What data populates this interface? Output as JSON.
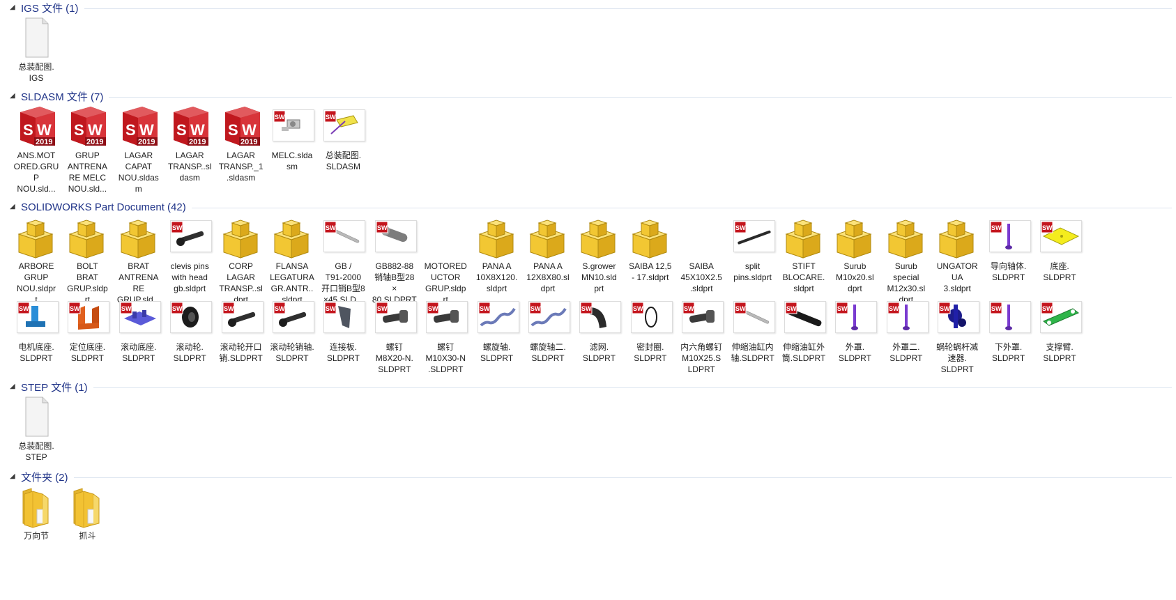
{
  "colors": {
    "group_title": "#1e3287",
    "sw_red": "#c0181e",
    "folder_yellow": "#f2c233"
  },
  "groups": [
    {
      "title": "IGS 文件 (1)",
      "items": [
        {
          "name": "总装配图.IGS",
          "lines": [
            "总装配图.",
            "IGS"
          ],
          "icon": "blank-file-icon"
        }
      ]
    },
    {
      "title": "SLDASM 文件 (7)",
      "items": [
        {
          "name": "ANS.MOTORED.GRUP NOU.sld...",
          "lines": [
            "ANS.MOT",
            "ORED.GRU",
            "P",
            "NOU.sld..."
          ],
          "icon": "sw2019-icon"
        },
        {
          "name": "GRUP ANTRENARE MELC NOU.sld...",
          "lines": [
            "GRUP",
            "ANTRENA",
            "RE MELC",
            "NOU.sld..."
          ],
          "icon": "sw2019-icon"
        },
        {
          "name": "LAGAR CAPAT NOU.sldasm",
          "lines": [
            "LAGAR",
            "CAPAT",
            "NOU.sldas",
            "m"
          ],
          "icon": "sw2019-icon"
        },
        {
          "name": "LAGAR TRANSP..sldasm",
          "lines": [
            "LAGAR",
            "TRANSP..sl",
            "dasm"
          ],
          "icon": "sw2019-icon"
        },
        {
          "name": "LAGAR TRANSP._1.sldasm",
          "lines": [
            "LAGAR",
            "TRANSP._1",
            ".sldasm"
          ],
          "icon": "sw2019-icon"
        },
        {
          "name": "MELC.sldasm",
          "lines": [
            "MELC.slda",
            "sm"
          ],
          "icon": "assembly-thumb-icon",
          "thumb": "assembly-gray"
        },
        {
          "name": "总装配图.SLDASM",
          "lines": [
            "总装配图.",
            "SLDASM"
          ],
          "icon": "assembly-thumb-icon",
          "thumb": "assembly-yellow"
        }
      ]
    },
    {
      "title": "SOLIDWORKS Part Document (42)",
      "items": [
        {
          "name": "ARBORE GRUP NOU.sldprt",
          "lines": [
            "ARBORE",
            "GRUP",
            "NOU.sldpr",
            "t"
          ],
          "icon": "part-block-icon"
        },
        {
          "name": "BOLT BRAT GRUP.sldprt",
          "lines": [
            "BOLT",
            "BRAT",
            "GRUP.sldp",
            "rt"
          ],
          "icon": "part-block-icon"
        },
        {
          "name": "BRAT ANTRENARE GRUP.sld...",
          "lines": [
            "BRAT",
            "ANTRENA",
            "RE",
            "GRUP.sld..."
          ],
          "icon": "part-block-icon"
        },
        {
          "name": "clevis pins with head gb.sldprt",
          "lines": [
            "clevis pins",
            "with head",
            "gb.sldprt"
          ],
          "icon": "part-thumb-icon",
          "thumb": "pin-dark"
        },
        {
          "name": "CORP LAGAR TRANSP..sldprt",
          "lines": [
            "CORP",
            "LAGAR",
            "TRANSP..sl",
            "dprt"
          ],
          "icon": "part-block-icon"
        },
        {
          "name": "FLANSA LEGATURA GR.ANTR..sldprt",
          "lines": [
            "FLANSA",
            "LEGATURA",
            "GR.ANTR..",
            "sldprt"
          ],
          "icon": "part-block-icon"
        },
        {
          "name": "GB / T91-2000 开口销B型8×45.SLD...",
          "lines": [
            "GB /",
            "T91-2000",
            "开口销B型8",
            "×45.SLD..."
          ],
          "icon": "part-thumb-icon",
          "thumb": "pin-silver"
        },
        {
          "name": "GB882-88 销轴B型28×80.SLDPRT",
          "lines": [
            "GB882-88",
            "销轴B型28",
            "×",
            "80.SLDPRT"
          ],
          "icon": "part-thumb-icon",
          "thumb": "shaft-gray"
        },
        {
          "name": "MOTOREDUCTOR GRUP.sldprt",
          "lines": [
            "MOTORED",
            "UCTOR",
            "GRUP.sldp",
            "rt"
          ],
          "icon": "none"
        },
        {
          "name": "PANA A 10X8X120.sldprt",
          "lines": [
            "PANA  A",
            "10X8X120.",
            "sldprt"
          ],
          "icon": "part-block-icon"
        },
        {
          "name": "PANA A 12X8X80.sldprt",
          "lines": [
            "PANA  A",
            "12X8X80.sl",
            "dprt"
          ],
          "icon": "part-block-icon"
        },
        {
          "name": "S.grower MN10.sldprt",
          "lines": [
            "S.grower",
            "MN10.sld",
            "prt"
          ],
          "icon": "part-block-icon"
        },
        {
          "name": "SAIBA 12,5 - 17.sldprt",
          "lines": [
            "SAIBA 12,5",
            "- 17.sldprt"
          ],
          "icon": "part-block-icon"
        },
        {
          "name": "SAIBA 45X10X2.5.sldprt",
          "lines": [
            "SAIBA",
            "45X10X2.5",
            ".sldprt"
          ],
          "icon": "none"
        },
        {
          "name": "split pins.sldprt",
          "lines": [
            "split",
            "pins.sldprt"
          ],
          "icon": "part-thumb-icon",
          "thumb": "pin-black"
        },
        {
          "name": "STIFT BLOCARE.sldprt",
          "lines": [
            "STIFT",
            "BLOCARE.",
            "sldprt"
          ],
          "icon": "part-block-icon"
        },
        {
          "name": "Surub M10x20.sldprt",
          "lines": [
            "Surub",
            "M10x20.sl",
            "dprt"
          ],
          "icon": "part-block-icon"
        },
        {
          "name": "Surub special M12x30.sldprt",
          "lines": [
            "Surub",
            "special",
            "M12x30.sl",
            "dprt"
          ],
          "icon": "part-block-icon"
        },
        {
          "name": "UNGATORUA 3.sldprt",
          "lines": [
            "UNGATOR",
            "UA",
            "3.sldprt"
          ],
          "icon": "part-block-icon"
        },
        {
          "name": "导向轴体.SLDPRT",
          "lines": [
            "导向轴体.",
            "SLDPRT"
          ],
          "icon": "part-thumb-icon",
          "thumb": "rod-purple"
        },
        {
          "name": "底座.SLDPRT",
          "lines": [
            "底座.",
            "SLDPRT"
          ],
          "icon": "part-thumb-icon",
          "thumb": "plate-yellow"
        },
        {
          "name": "电机底座.SLDPRT",
          "lines": [
            "电机底座.",
            "SLDPRT"
          ],
          "icon": "part-thumb-icon",
          "thumb": "mount-blue"
        },
        {
          "name": "定位底座.SLDPRT",
          "lines": [
            "定位底座.",
            "SLDPRT"
          ],
          "icon": "part-thumb-icon",
          "thumb": "bracket-orange"
        },
        {
          "name": "滚动底座.SLDPRT",
          "lines": [
            "滚动底座.",
            "SLDPRT"
          ],
          "icon": "part-thumb-icon",
          "thumb": "base-violet"
        },
        {
          "name": "滚动轮.SLDPRT",
          "lines": [
            "滚动轮.",
            "SLDPRT"
          ],
          "icon": "part-thumb-icon",
          "thumb": "wheel-black"
        },
        {
          "name": "滚动轮开口销.SLDPRT",
          "lines": [
            "滚动轮开口",
            "销.SLDPRT"
          ],
          "icon": "part-thumb-icon",
          "thumb": "pin-dark"
        },
        {
          "name": "滚动轮销轴.SLDPRT",
          "lines": [
            "滚动轮销轴.",
            "SLDPRT"
          ],
          "icon": "part-thumb-icon",
          "thumb": "pin-dark"
        },
        {
          "name": "连接板.SLDPRT",
          "lines": [
            "连接板.",
            "SLDPRT"
          ],
          "icon": "part-thumb-icon",
          "thumb": "plate-gray"
        },
        {
          "name": "螺钉M8X20-N.SLDPRT",
          "lines": [
            "螺钉",
            "M8X20-N.",
            "SLDPRT"
          ],
          "icon": "part-thumb-icon",
          "thumb": "bolt-dark"
        },
        {
          "name": "螺钉M10X30-N.SLDPRT",
          "lines": [
            "螺钉",
            "M10X30-N",
            ".SLDPRT"
          ],
          "icon": "part-thumb-icon",
          "thumb": "bolt-dark"
        },
        {
          "name": "螺旋轴.SLDPRT",
          "lines": [
            "螺旋轴.",
            "SLDPRT"
          ],
          "icon": "part-thumb-icon",
          "thumb": "screw-blue"
        },
        {
          "name": "螺旋轴二.SLDPRT",
          "lines": [
            "螺旋轴二.",
            "SLDPRT"
          ],
          "icon": "part-thumb-icon",
          "thumb": "screw-blue"
        },
        {
          "name": "滤网.SLDPRT",
          "lines": [
            "滤网.",
            "SLDPRT"
          ],
          "icon": "part-thumb-icon",
          "thumb": "elbow-black"
        },
        {
          "name": "密封圈.SLDPRT",
          "lines": [
            "密封圈.",
            "SLDPRT"
          ],
          "icon": "part-thumb-icon",
          "thumb": "ring-black"
        },
        {
          "name": "内六角螺钉M10X25.SLDPRT",
          "lines": [
            "内六角螺钉",
            "M10X25.S",
            "LDPRT"
          ],
          "icon": "part-thumb-icon",
          "thumb": "bolt-dark"
        },
        {
          "name": "伸缩油缸内轴.SLDPRT",
          "lines": [
            "伸缩油缸内",
            "轴.SLDPRT"
          ],
          "icon": "part-thumb-icon",
          "thumb": "pin-silver"
        },
        {
          "name": "伸缩油缸外筒.SLDPRT",
          "lines": [
            "伸缩油缸外",
            "筒.SLDPRT"
          ],
          "icon": "part-thumb-icon",
          "thumb": "tube-black"
        },
        {
          "name": "外罩.SLDPRT",
          "lines": [
            "外罩.",
            "SLDPRT"
          ],
          "icon": "part-thumb-icon",
          "thumb": "rod-purple"
        },
        {
          "name": "外罩二.SLDPRT",
          "lines": [
            "外罩二.",
            "SLDPRT"
          ],
          "icon": "part-thumb-icon",
          "thumb": "rod-purple"
        },
        {
          "name": "蜗轮蜗杆减速器.SLDPRT",
          "lines": [
            "蜗轮蜗杆减",
            "速器.",
            "SLDPRT"
          ],
          "icon": "part-thumb-icon",
          "thumb": "gear-navy"
        },
        {
          "name": "下外罩.SLDPRT",
          "lines": [
            "下外罩.",
            "SLDPRT"
          ],
          "icon": "part-thumb-icon",
          "thumb": "rod-purple"
        },
        {
          "name": "支撑臂.SLDPRT",
          "lines": [
            "支撑臂.",
            "SLDPRT"
          ],
          "icon": "part-thumb-icon",
          "thumb": "arm-green"
        }
      ]
    },
    {
      "title": "STEP 文件 (1)",
      "items": [
        {
          "name": "总装配图.STEP",
          "lines": [
            "总装配图.",
            "STEP"
          ],
          "icon": "blank-file-icon"
        }
      ]
    },
    {
      "title": "文件夹 (2)",
      "items": [
        {
          "name": "万向节",
          "lines": [
            "万向节"
          ],
          "icon": "folder-icon"
        },
        {
          "name": "抓斗",
          "lines": [
            "抓斗"
          ],
          "icon": "folder-icon"
        }
      ]
    }
  ]
}
